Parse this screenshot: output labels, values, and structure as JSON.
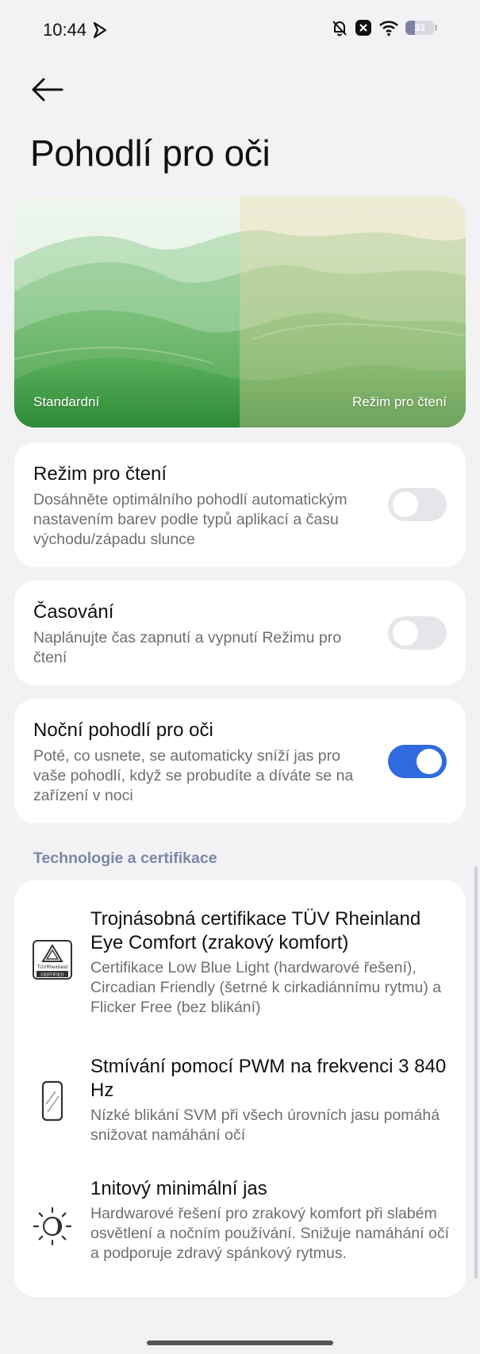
{
  "status_bar": {
    "time": "10:44",
    "battery_level": "33",
    "battery_fraction": 0.33,
    "icons": [
      "play-icon",
      "bell-muted-icon",
      "close-box-icon",
      "wifi-icon",
      "battery-icon"
    ]
  },
  "header": {
    "title": "Pohodlí pro oči"
  },
  "preview": {
    "left_label": "Standardní",
    "right_label": "Režim pro čtení"
  },
  "settings": {
    "reading_mode": {
      "title": "Režim pro čtení",
      "description": "Dosáhněte optimálního pohodlí automatickým nastavením barev podle typů aplikací a času východu/západu slunce",
      "enabled": false
    },
    "scheduling": {
      "title": "Časování",
      "description": "Naplánujte čas zapnutí a vypnutí Režimu pro čtení",
      "enabled": false
    },
    "night_comfort": {
      "title": "Noční pohodlí pro oči",
      "description": "Poté, co usnete, se automaticky sníží jas pro vaše pohodlí, když se probudíte a díváte se na zařízení v noci",
      "enabled": true
    }
  },
  "tech_section": {
    "header": "Technologie a certifikace",
    "items": [
      {
        "icon": "tuv-certificate-icon",
        "title": "Trojnásobná certifikace TÜV Rheinland Eye Comfort (zrakový komfort)",
        "description": "Certifikace Low Blue Light (hardwarové řešení), Circadian Friendly (šetrné k cirkadiánnímu rytmu) a Flicker Free (bez blikání)",
        "badge_text": [
          "TÜVRheinland",
          "CERTIFIED"
        ]
      },
      {
        "icon": "phone-screen-icon",
        "title": "Stmívání pomocí PWM na frekvenci 3 840 Hz",
        "description": "Nízké blikání SVM při všech úrovních jasu pomáhá snižovat namáhání očí"
      },
      {
        "icon": "brightness-icon",
        "title": "1nitový minimální jas",
        "description": "Hardwarové řešení pro zrakový komfort při slabém osvětlení a nočním používání. Snižuje namáhání očí a podporuje zdravý spánkový rytmus."
      }
    ]
  },
  "colors": {
    "background": "#f2f2f4",
    "card": "#ffffff",
    "accent": "#2f6bde",
    "section_header": "#7a87a8"
  }
}
